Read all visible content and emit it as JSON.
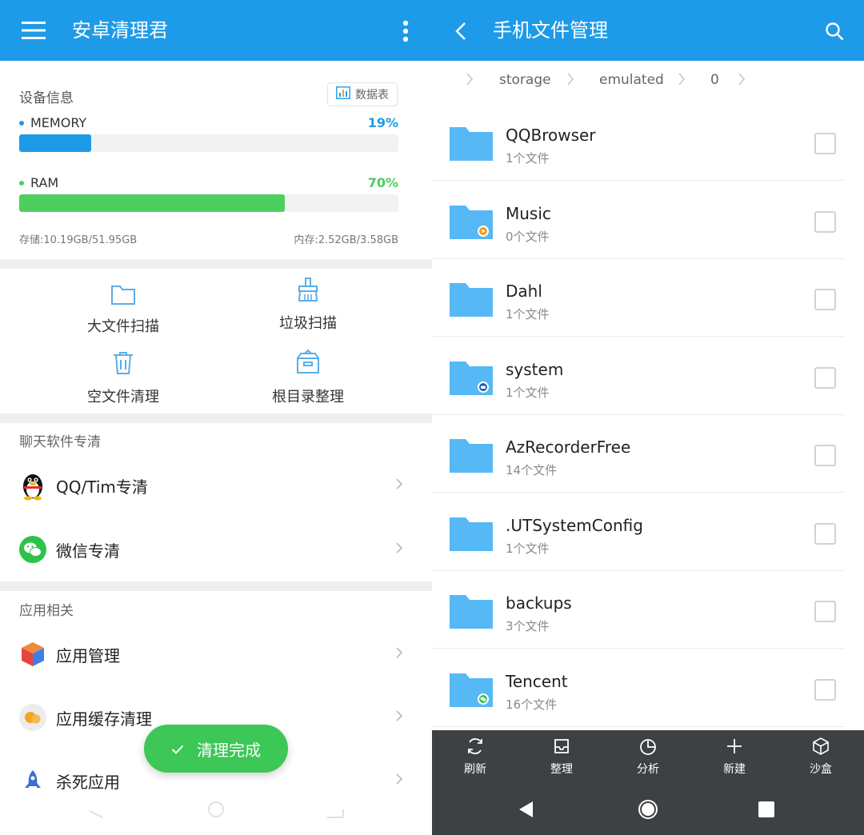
{
  "left": {
    "appbar": {
      "title": "安卓清理君",
      "icons": [
        "menu-icon",
        "more-vert-icon"
      ]
    },
    "device": {
      "title": "设备信息",
      "chip_label": "数据表",
      "memory": {
        "label": "MEMORY",
        "percent_text": "19%",
        "fraction": 0.19,
        "color": "#1e9be8"
      },
      "ram": {
        "label": "RAM",
        "percent_text": "70%",
        "fraction": 0.7,
        "color": "#4ccf5f"
      },
      "storage_text": "存储:10.19GB/51.95GB",
      "mem_text": "内存:2.52GB/3.58GB"
    },
    "tools": [
      {
        "label": "大文件扫描",
        "icon": "folder-outline-icon"
      },
      {
        "label": "垃圾扫描",
        "icon": "broom-icon"
      },
      {
        "label": "空文件清理",
        "icon": "trash-icon"
      },
      {
        "label": "根目录整理",
        "icon": "toolbox-icon"
      }
    ],
    "chat_section": {
      "title": "聊天软件专清",
      "items": [
        {
          "label": "QQ/Tim专清",
          "icon": "qq-penguin-icon"
        },
        {
          "label": "微信专清",
          "icon": "wechat-icon"
        }
      ]
    },
    "app_section": {
      "title": "应用相关",
      "items": [
        {
          "label": "应用管理",
          "icon": "cube-icon"
        },
        {
          "label": "应用缓存清理",
          "icon": "cache-icon"
        },
        {
          "label": "杀死应用",
          "icon": "rocket-icon"
        }
      ]
    },
    "toast": {
      "label": "清理完成",
      "icon": "check-icon"
    },
    "accent": "#1e9be8",
    "success": "#3cc756"
  },
  "right": {
    "appbar": {
      "title": "手机文件管理",
      "icons": [
        "back-icon",
        "search-icon"
      ]
    },
    "breadcrumb": [
      "storage",
      "emulated",
      "0"
    ],
    "files": [
      {
        "name": "QQBrowser",
        "count": "1个文件",
        "badge": ""
      },
      {
        "name": "Music",
        "count": "0个文件",
        "badge": "music"
      },
      {
        "name": "Dahl",
        "count": "1个文件",
        "badge": ""
      },
      {
        "name": "system",
        "count": "1个文件",
        "badge": "system"
      },
      {
        "name": "AzRecorderFree",
        "count": "14个文件",
        "badge": ""
      },
      {
        "name": ".UTSystemConfig",
        "count": "1个文件",
        "badge": ""
      },
      {
        "name": "backups",
        "count": "3个文件",
        "badge": ""
      },
      {
        "name": "Tencent",
        "count": "16个文件",
        "badge": "wechat"
      }
    ],
    "toolbar": [
      {
        "label": "刷新",
        "icon": "refresh-icon"
      },
      {
        "label": "整理",
        "icon": "inbox-icon"
      },
      {
        "label": "分析",
        "icon": "pie-icon"
      },
      {
        "label": "新建",
        "icon": "plus-icon"
      },
      {
        "label": "沙盒",
        "icon": "box-icon"
      }
    ],
    "folder_color": "#56b8f5"
  }
}
